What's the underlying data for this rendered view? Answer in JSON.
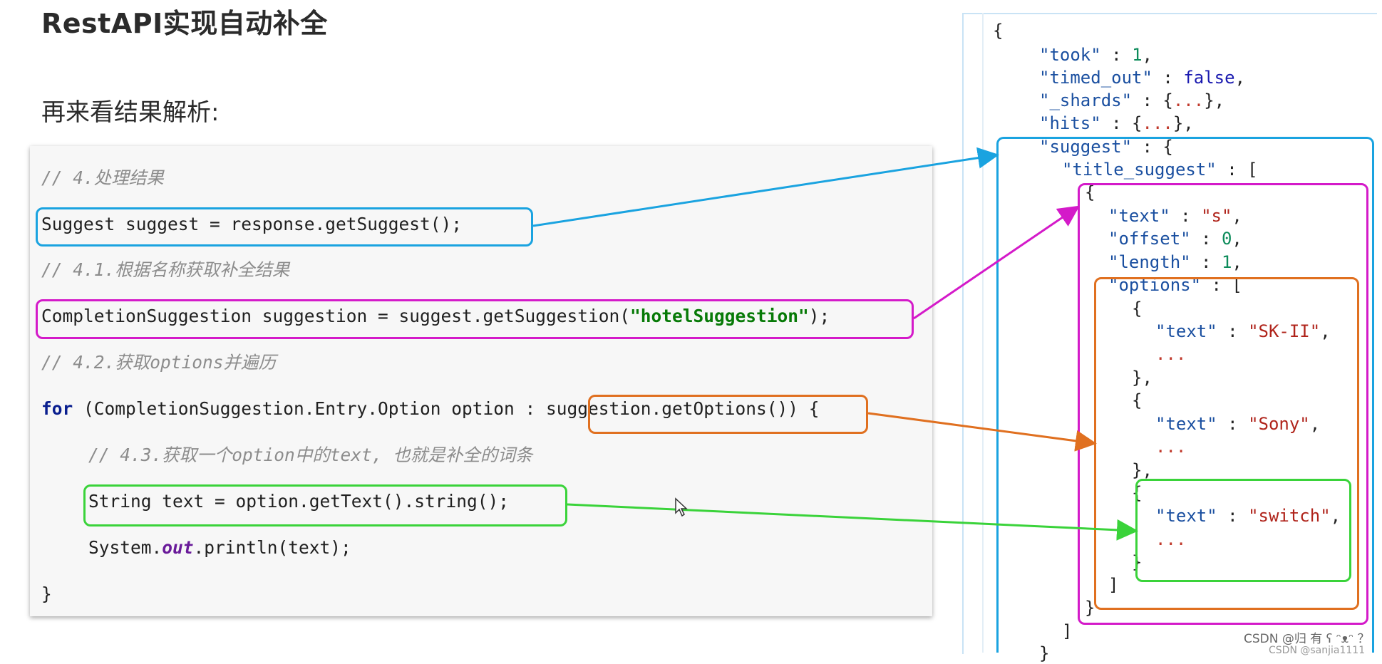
{
  "slide": {
    "title": "RestAPI实现自动补全",
    "subtitle": "再来看结果解析:"
  },
  "code": {
    "comment_1": "// 4.处理结果",
    "line_1": "Suggest suggest = response.getSuggest();",
    "comment_2": "// 4.1.根据名称获取补全结果",
    "line_2_prefix": "CompletionSuggestion suggestion = suggest.getSuggestion(",
    "line_2_string": "\"hotelSuggestion\"",
    "line_2_suffix": ");",
    "comment_3": "// 4.2.获取options并遍历",
    "line_3_keyword": "for",
    "line_3_rest": " (CompletionSuggestion.Entry.Option option : suggestion.getOptions()) {",
    "comment_4": "// 4.3.获取一个option中的text, 也就是补全的词条",
    "line_4": "String text = option.getText().string();",
    "line_5_prefix": "System.",
    "line_5_out": "out",
    "line_5_suffix": ".println(text);",
    "line_6": "}"
  },
  "json": {
    "open_brace": "{",
    "took_key": "\"took\"",
    "took_val": "1",
    "timed_out_key": "\"timed_out\"",
    "timed_out_val": "false",
    "shards_key": "\"_shards\"",
    "hits_key": "\"hits\"",
    "collapsed": "...",
    "suggest_key": "\"suggest\"",
    "title_suggest_key": "\"title_suggest\"",
    "text_key": "\"text\"",
    "text_val": "\"s\"",
    "offset_key": "\"offset\"",
    "offset_val": "0",
    "length_key": "\"length\"",
    "length_val": "1",
    "options_key": "\"options\"",
    "opt1_text": "\"SK-II\"",
    "opt2_text": "\"Sony\"",
    "opt3_text": "\"switch\"",
    "ellipsis": "..."
  },
  "colors": {
    "suggest_box": "#1aa3e0",
    "suggestion_box": "#d41ac9",
    "options_box": "#e07020",
    "text_box": "#3ad33a"
  },
  "watermark": {
    "line1": "CSDN @归 有 ʕ ᵔᴥᵔ ？",
    "line2": "CSDN @sanjia1111"
  }
}
